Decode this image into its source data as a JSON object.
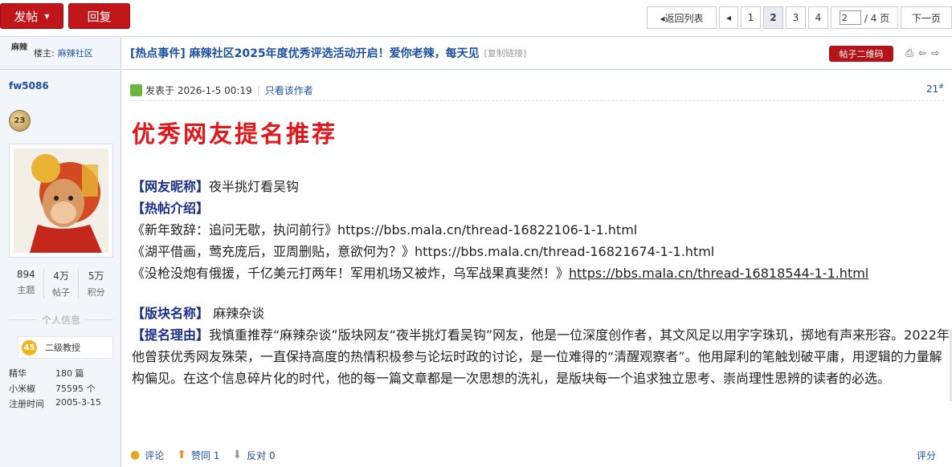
{
  "toolbar": {
    "post_label": "发帖",
    "reply_label": "回复"
  },
  "pager": {
    "back_label": "◂返回列表",
    "pages": [
      "1",
      "2",
      "3",
      "4"
    ],
    "current_page": "2",
    "page_input": "2",
    "total_label": "/ 4 页",
    "next_label": "下一页"
  },
  "sidebar": {
    "logo_text": "麻辣",
    "op_prefix": "楼主:",
    "op_name": "麻辣社区",
    "username": "fw5086",
    "medal": "23",
    "stats": [
      {
        "value": "894",
        "label": "主题"
      },
      {
        "value": "4万",
        "label": "帖子"
      },
      {
        "value": "5万",
        "label": "积分"
      }
    ],
    "info_title": "个人信息",
    "level_badge": "45",
    "level_name": "二级教授",
    "kv": [
      {
        "key": "精华",
        "value": "180 篇"
      },
      {
        "key": "小米椒",
        "value": "75595 个"
      },
      {
        "key": "注册时间",
        "value": "2005-3-15"
      }
    ]
  },
  "thread": {
    "title": "[热点事件] 麻辣社区2025年度优秀评选活动开启！爱你老辣，每天见",
    "copy_link": "[复制链接]",
    "qr_label": "帖子二维码"
  },
  "post": {
    "posted_at": "发表于 2026-1-5 00:19",
    "only_author": "只看该作者",
    "floor": "21",
    "floor_mark": "#",
    "heading": "优秀网友提名推荐",
    "nick_label": "【网友昵称】",
    "nick_value": "夜半挑灯看吴钩",
    "hot_label": "【热帖介绍】",
    "links": [
      "《新年致辞：追问无歇，执问前行》https://bbs.mala.cn/thread-16822106-1-1.html",
      "《湖平借画，莺充庞后，亚周删贴，意欲何为？》https://bbs.mala.cn/thread-16821674-1-1.html"
    ],
    "link3_text": "《没枪没炮有俄援，千亿美元打两年！军用机场又被炸，乌军战果真斐然！》",
    "link3_url": "https://bbs.mala.cn/thread-16818544-1-1.html",
    "board_label": "【版块名称】",
    "board_value": " 麻辣杂谈",
    "reason_label": "【提名理由】",
    "reason_text": "我慎重推荐“麻辣杂谈”版块网友“夜半挑灯看吴钩”网友，他是一位深度创作者，其文风足以用字字珠玑，掷地有声来形容。2022年他曾获优秀网友殊荣，一直保持高度的热情积极参与论坛时政的讨论，是一位难得的“清醒观察者”。他用犀利的笔触划破平庸，用逻辑的力量解构偏见。在这个信息碎片化的时代，他的每一篇文章都是一次思想的洗礼，是版块每一个追求独立思考、崇尚理性思辨的读者的必选。"
  },
  "footer": {
    "comment": "评论",
    "like": "赞同 1",
    "dislike": "反对 0",
    "rate": "评分"
  }
}
